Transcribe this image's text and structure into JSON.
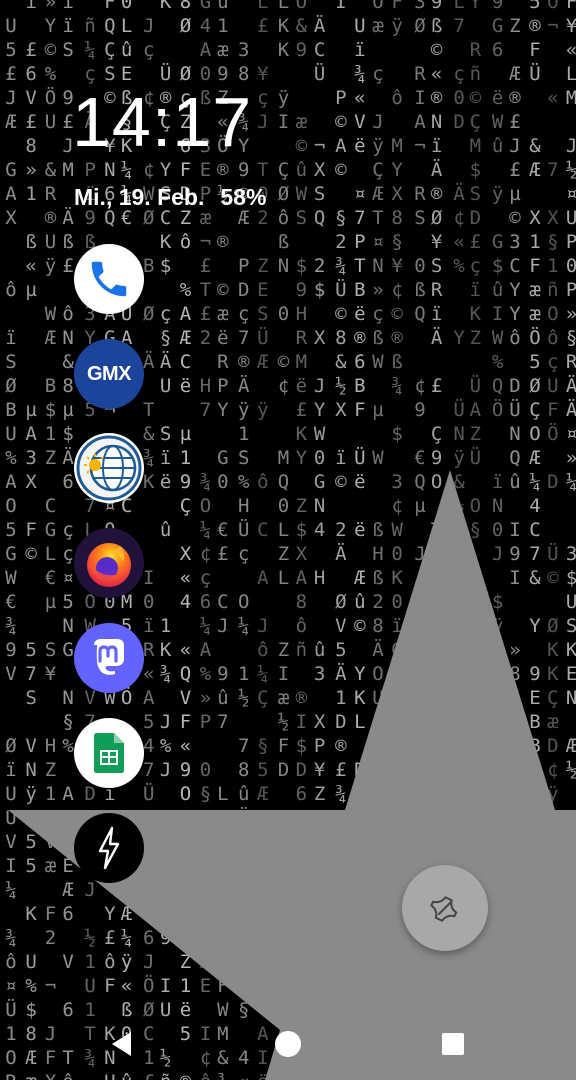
{
  "lockscreen": {
    "time": "14:17",
    "date": "Mi., 19. Feb.",
    "battery": "58%"
  },
  "apps": [
    {
      "name": "Phone",
      "icon": "phone-icon"
    },
    {
      "name": "GMX",
      "icon": "gmx-icon",
      "label": "GMX"
    },
    {
      "name": "Weather",
      "icon": "weather-globe-icon"
    },
    {
      "name": "Firefox",
      "icon": "firefox-icon"
    },
    {
      "name": "Mastodon",
      "icon": "mastodon-icon"
    },
    {
      "name": "Google Sheets",
      "icon": "sheets-icon"
    },
    {
      "name": "Power",
      "icon": "lightning-icon"
    }
  ],
  "fab": {
    "icon": "sticky-note-icon"
  },
  "nav": {
    "back": "back-icon",
    "home": "home-icon",
    "recents": "recents-icon"
  },
  "colors": {
    "wallpaper_bg": "#000000",
    "matrix_glyph": "#b9b9b9",
    "overlay_gray": "#8a8a8a",
    "gmx_blue": "#1c449b",
    "mastodon_purple": "#6364ff",
    "sheets_green": "#0f9d58",
    "phone_blue": "#1a73e8"
  }
}
